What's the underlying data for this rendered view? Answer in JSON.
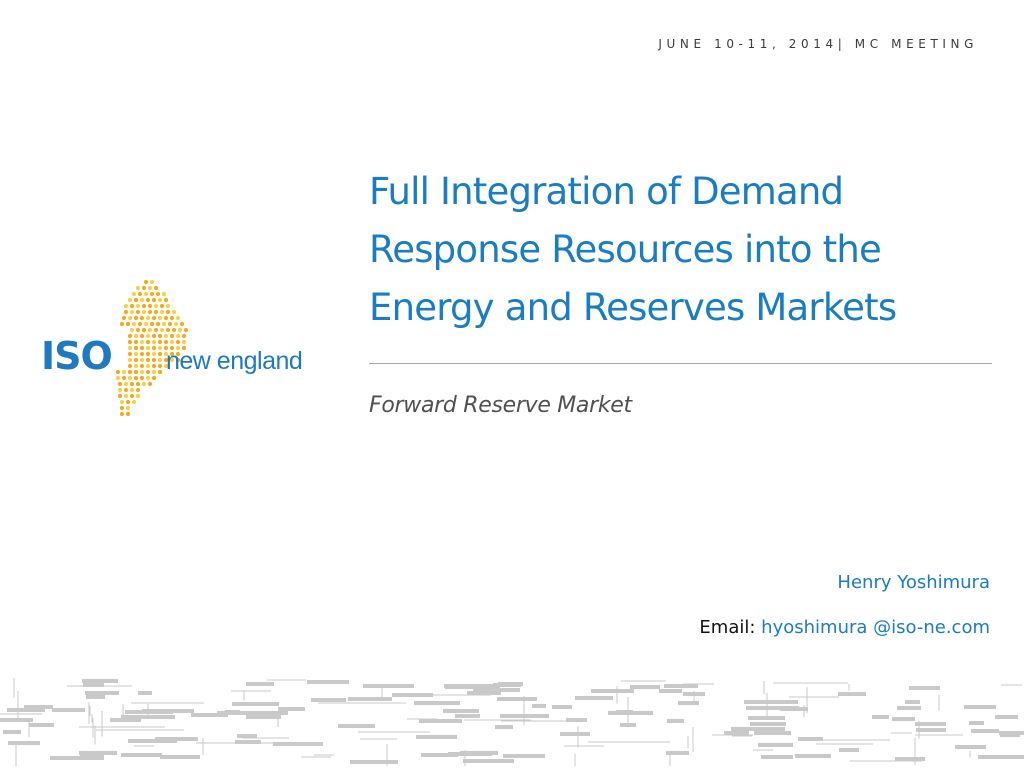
{
  "header": {
    "meeting": "JUNE 10-11, 2014| MC MEETING"
  },
  "logo": {
    "iso": "ISO",
    "new_england": "new england",
    "brand_blue": "#1f79bf",
    "dot_orange": "#f4a91c",
    "dot_yellow": "#f8cf47"
  },
  "title": {
    "line1": "Full Integration of Demand",
    "line2": "Response Resources into the",
    "line3": "Energy and Reserves Markets",
    "color": "#1a7cc1"
  },
  "subtitle": "Forward Reserve Market",
  "presenter": {
    "name": "Henry Yoshimura",
    "email_label": "Email:",
    "email_value": "hyoshimura @iso-ne.com"
  },
  "decoration": {
    "circuit_color": "#c9c9c9"
  }
}
